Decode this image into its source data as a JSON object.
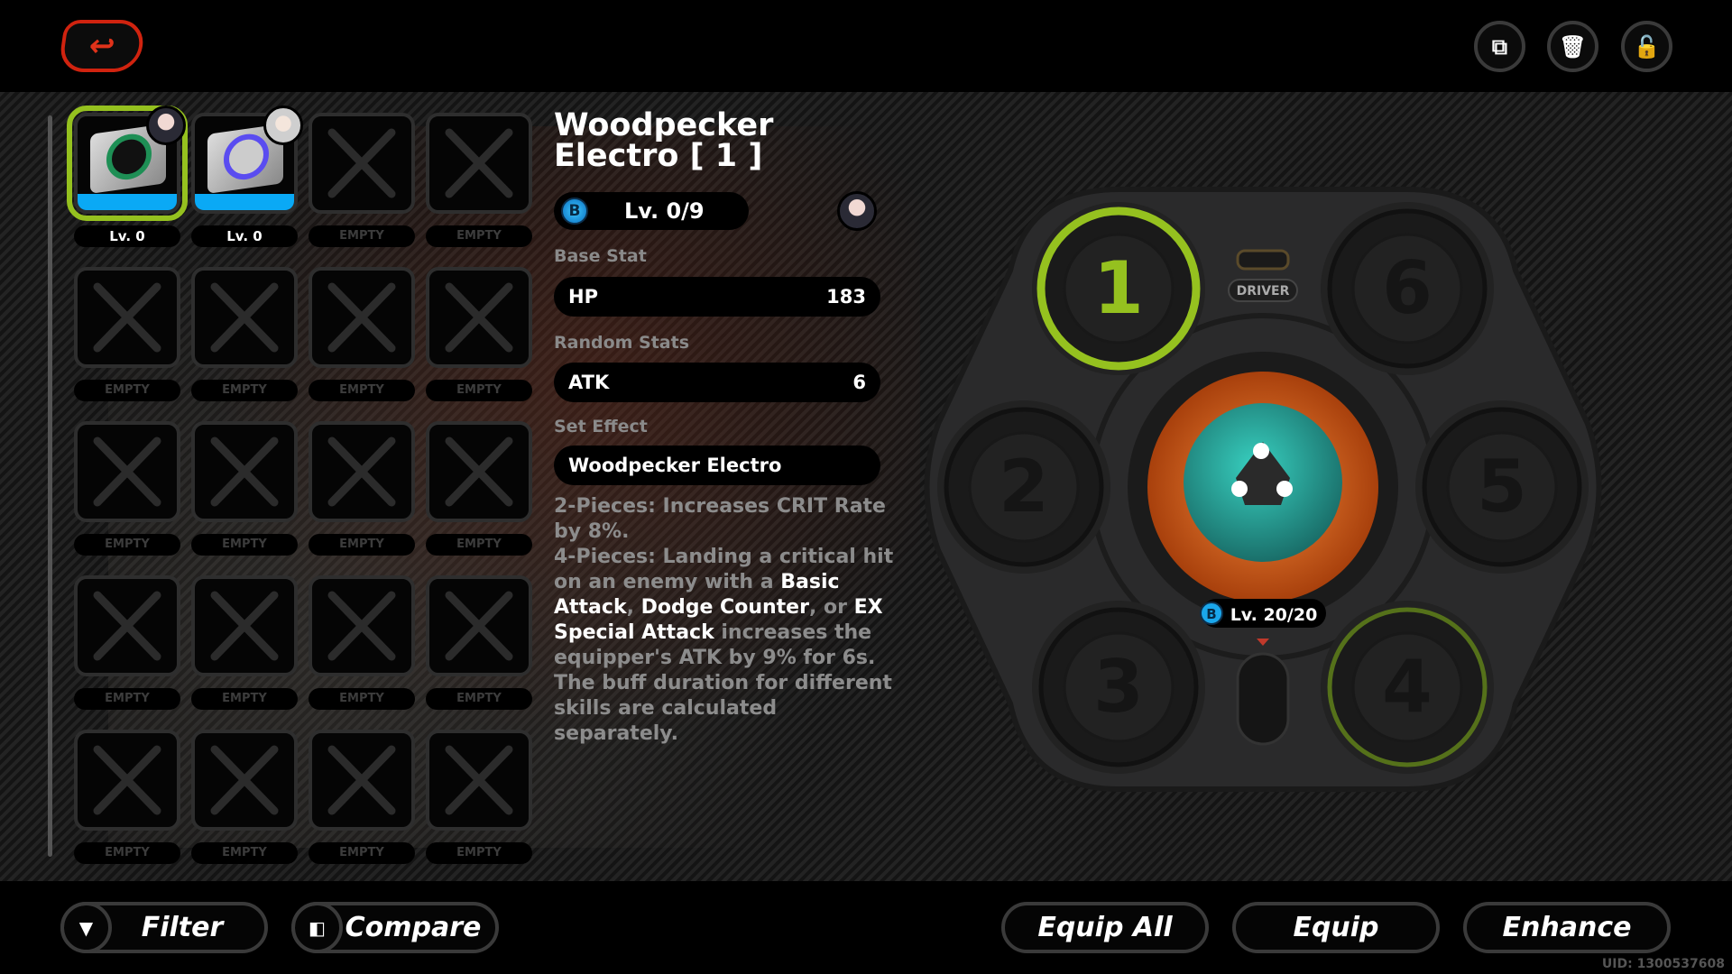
{
  "header": {
    "back_icon": "undo-arrow-icon",
    "actions": [
      {
        "name": "share-icon",
        "glyph": "⧉"
      },
      {
        "name": "trash-icon",
        "glyph": "🗑"
      },
      {
        "name": "unlock-icon",
        "glyph": "🔓"
      }
    ]
  },
  "inventory": {
    "items": [
      {
        "label": "Lv. 0",
        "filled": true,
        "selected": true,
        "art": "green",
        "avatar": "dark"
      },
      {
        "label": "Lv. 0",
        "filled": true,
        "selected": false,
        "art": "purple",
        "avatar": "white"
      },
      {
        "label": "EMPTY"
      },
      {
        "label": "EMPTY"
      },
      {
        "label": "EMPTY"
      },
      {
        "label": "EMPTY"
      },
      {
        "label": "EMPTY"
      },
      {
        "label": "EMPTY"
      },
      {
        "label": "EMPTY"
      },
      {
        "label": "EMPTY"
      },
      {
        "label": "EMPTY"
      },
      {
        "label": "EMPTY"
      },
      {
        "label": "EMPTY"
      },
      {
        "label": "EMPTY"
      },
      {
        "label": "EMPTY"
      },
      {
        "label": "EMPTY"
      },
      {
        "label": "EMPTY"
      },
      {
        "label": "EMPTY"
      },
      {
        "label": "EMPTY"
      },
      {
        "label": "EMPTY"
      }
    ]
  },
  "detail": {
    "title_line1": "Woodpecker",
    "title_line2": "Electro [ 1 ]",
    "rank": "B",
    "level": "Lv. 0/9",
    "base_stat_label": "Base Stat",
    "base_stat": {
      "name": "HP",
      "value": "183"
    },
    "random_stats_label": "Random Stats",
    "random_stats": [
      {
        "name": "ATK",
        "value": "6"
      }
    ],
    "set_effect_label": "Set Effect",
    "set_name": "Woodpecker Electro",
    "two_piece": "2-Pieces: Increases CRIT Rate by 8%.",
    "four_piece_a": "4-Pieces: Landing a critical hit on an enemy with a ",
    "four_piece_b": "Basic Attack",
    "four_piece_c": ", ",
    "four_piece_d": "Dodge Counter",
    "four_piece_e": ", or ",
    "four_piece_f": "EX Special Attack",
    "four_piece_g": " increases the equipper's ATK by 9% for 6s. The buff duration for different skills are calculated separately."
  },
  "driver_board": {
    "driver_label": "DRIVER",
    "slots": [
      {
        "n": "1",
        "state": "selected"
      },
      {
        "n": "2"
      },
      {
        "n": "3"
      },
      {
        "n": "4",
        "state": "highlight"
      },
      {
        "n": "5"
      },
      {
        "n": "6"
      }
    ],
    "w_engine_rank": "B",
    "w_engine_level": "Lv. 20/20",
    "accent": "#95c11f"
  },
  "footer": {
    "filter": "Filter",
    "compare": "Compare",
    "equip_all": "Equip All",
    "equip": "Equip",
    "enhance": "Enhance",
    "uid": "UID: 1300537608"
  }
}
